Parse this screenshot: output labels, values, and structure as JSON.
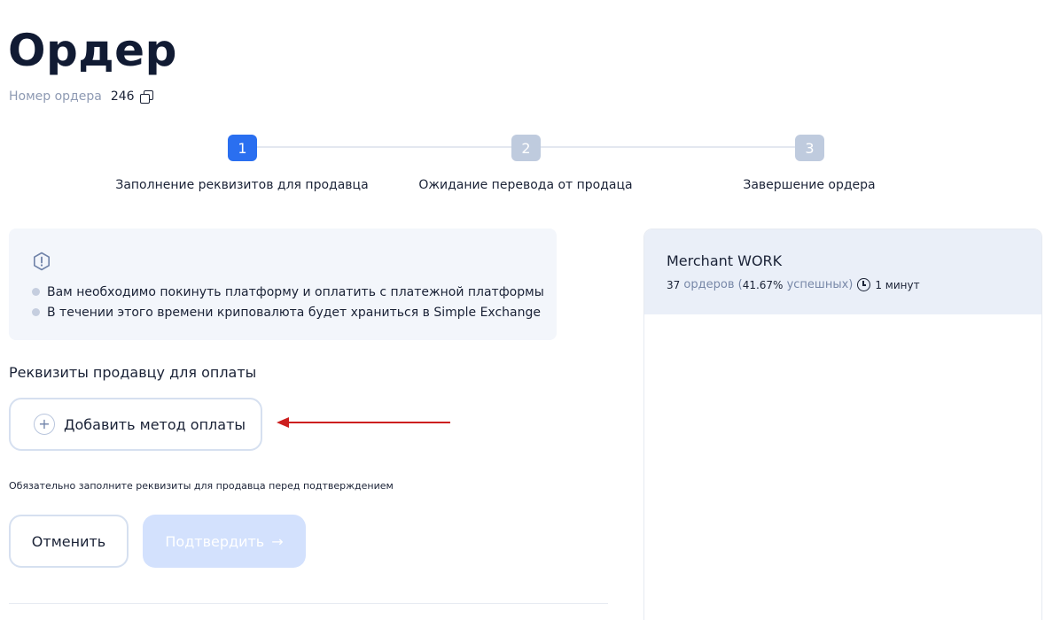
{
  "page": {
    "title": "Ордер",
    "order_number_label": "Номер ордера",
    "order_number": "246"
  },
  "steps": [
    {
      "number": "1",
      "label": "Заполнение реквизитов для продавца",
      "state": "active"
    },
    {
      "number": "2",
      "label": "Ожидание перевода от продаца",
      "state": "pending"
    },
    {
      "number": "3",
      "label": "Завершение ордера",
      "state": "pending"
    }
  ],
  "notice": {
    "icon": "warning-shield-icon",
    "items": [
      "Вам необходимо покинуть платформу и оплатить с платежной платформы",
      "В течении этого времени криповалюта будет храниться в Simple Exchange"
    ]
  },
  "payment": {
    "section_title": "Реквизиты продавцу для оплаты",
    "add_method_label": "Добавить метод оплаты",
    "hint": "Обязательно заполните реквизиты для продавца перед подтверждением"
  },
  "actions": {
    "cancel_label": "Отменить",
    "confirm_label": "Подтвердить",
    "confirm_arrow": "→"
  },
  "merchant": {
    "name": "Merchant WORK",
    "orders_count": "37",
    "orders_word": "ордеров (",
    "success_rate": "41.67%",
    "success_word": "успешных)",
    "time": "1 минут"
  },
  "colors": {
    "accent": "#2a6ff0",
    "step_idle": "#bfcbde",
    "annotation_arrow": "#cc1f1f",
    "confirm_disabled": "#d3e1fd"
  }
}
